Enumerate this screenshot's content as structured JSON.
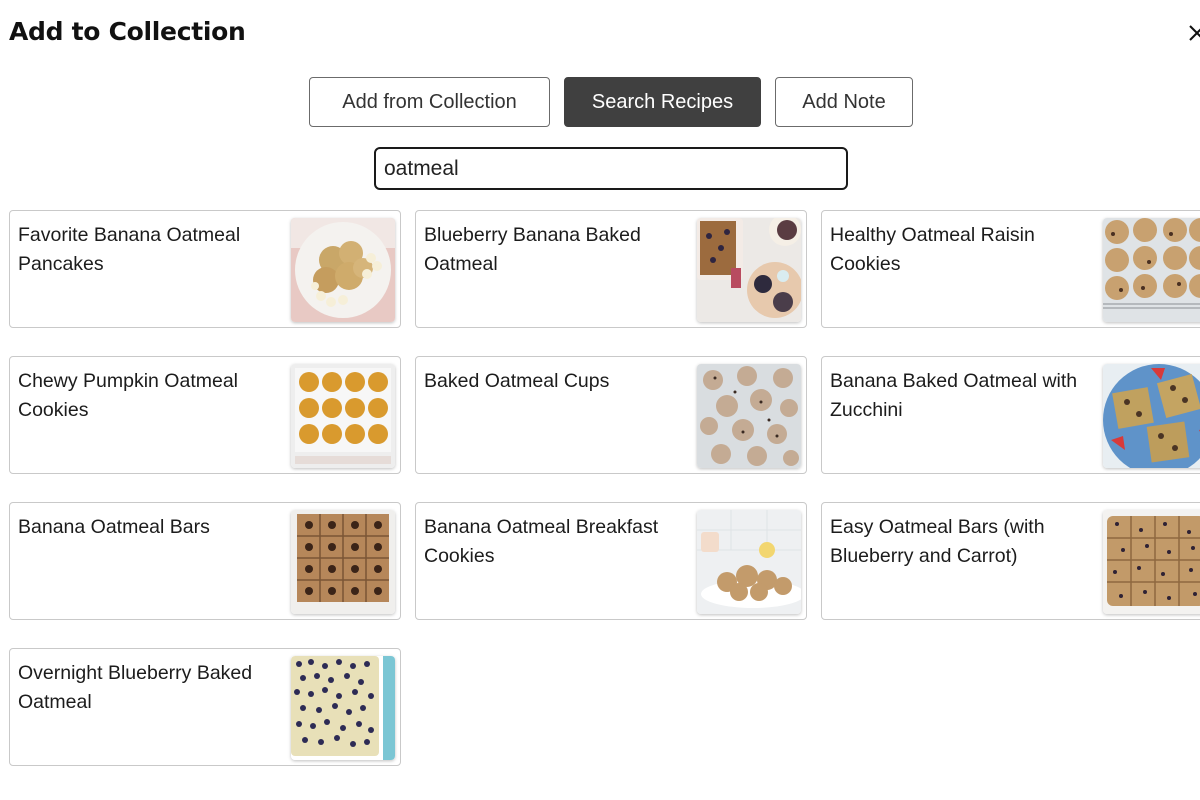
{
  "modal": {
    "title": "Add to Collection",
    "close_icon": "close-icon"
  },
  "tabs": [
    {
      "label": "Add from Collection",
      "active": false
    },
    {
      "label": "Search Recipes",
      "active": true
    },
    {
      "label": "Add Note",
      "active": false
    }
  ],
  "search": {
    "value": "oatmeal",
    "placeholder": ""
  },
  "results": [
    {
      "title": "Favorite Banana Oatmeal Pancakes",
      "image": "banana-oatmeal-pancakes-photo"
    },
    {
      "title": "Blueberry Banana Baked Oatmeal",
      "image": "blueberry-baked-oatmeal-photo"
    },
    {
      "title": "Healthy Oatmeal Raisin Cookies",
      "image": "oatmeal-raisin-cookies-photo"
    },
    {
      "title": "Chewy Pumpkin Oatmeal Cookies",
      "image": "pumpkin-oatmeal-cookies-photo"
    },
    {
      "title": "Baked Oatmeal Cups",
      "image": "baked-oatmeal-cups-photo"
    },
    {
      "title": "Banana Baked Oatmeal with Zucchini",
      "image": "zucchini-baked-oatmeal-photo"
    },
    {
      "title": "Banana Oatmeal Bars",
      "image": "banana-oatmeal-bars-photo"
    },
    {
      "title": "Banana Oatmeal Breakfast Cookies",
      "image": "breakfast-cookies-photo"
    },
    {
      "title": "Easy Oatmeal Bars (with Blueberry and Carrot)",
      "image": "blueberry-carrot-bars-photo"
    },
    {
      "title": "Overnight Blueberry Baked Oatmeal",
      "image": "overnight-blueberry-oatmeal-photo"
    }
  ],
  "colors": {
    "active_tab_bg": "#404040",
    "border": "#c9c9c9"
  }
}
